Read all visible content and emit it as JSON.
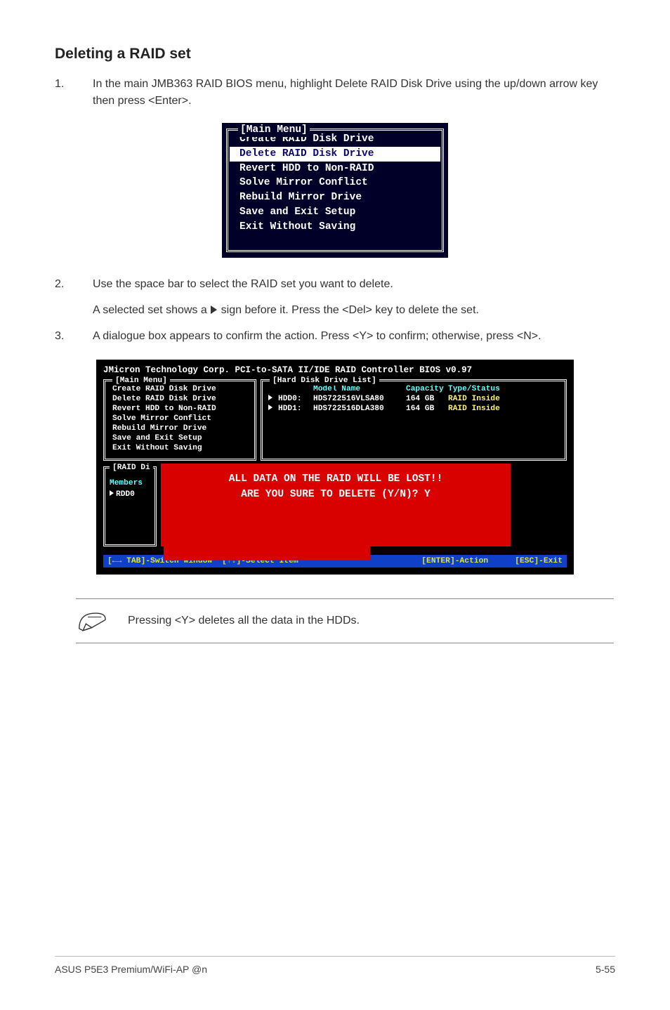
{
  "heading": "Deleting a RAID set",
  "steps": {
    "s1_num": "1.",
    "s1_text": "In the main JMB363 RAID BIOS menu, highlight Delete RAID Disk Drive using the up/down arrow key then press <Enter>.",
    "s2_num": "2.",
    "s2_text": "Use the space bar to select the RAID set you want to delete.",
    "s2_extra_a": "A selected set shows a ",
    "s2_extra_b": " sign before it. Press the <Del> key to delete the set.",
    "s3_num": "3.",
    "s3_text": "A dialogue box appears to confirm the action. Press <Y> to confirm; otherwise, press <N>."
  },
  "small_menu": {
    "title": "[Main Menu]",
    "items": [
      "Create RAID Disk Drive",
      "Delete RAID Disk Drive",
      "Revert HDD to Non-RAID",
      "Solve Mirror Conflict",
      "Rebuild Mirror Drive",
      "Save and Exit Setup",
      "Exit Without Saving"
    ],
    "selected_index": 1
  },
  "large": {
    "title": "JMicron Technology Corp. PCI-to-SATA II/IDE RAID Controller BIOS v0.97",
    "main_title": "[Main Menu]",
    "main_items": [
      "Create RAID Disk Drive",
      "Delete RAID Disk Drive",
      "Revert HDD to Non-RAID",
      "Solve Mirror Conflict",
      "Rebuild Mirror Drive",
      "Save and Exit Setup",
      "Exit Without Saving"
    ],
    "hdd_title": "[Hard Disk Drive List]",
    "hdd_header": {
      "model": "Model Name",
      "cap": "Capacity",
      "type": "Type/Status"
    },
    "hdd_rows": [
      {
        "slot": "HDD0:",
        "model": "HDS722516VLSA80",
        "cap": "164 GB",
        "type": "RAID Inside"
      },
      {
        "slot": "HDD1:",
        "model": "HDS722516DLA380",
        "cap": "164 GB",
        "type": "RAID Inside"
      }
    ],
    "raid_title": "[RAID Di",
    "raid_members": "Members",
    "raid_entry": "RDD0",
    "redbox_line1": "ALL DATA ON THE RAID WILL BE LOST!!",
    "redbox_line2": "ARE YOU SURE TO DELETE (Y/N)? Y",
    "keybar": {
      "tab": "TAB]-Switch Window",
      "sel": "[↑↓]-Select Item",
      "enter": "[ENTER]-Action",
      "esc": "[ESC]-Exit"
    }
  },
  "note": "Pressing <Y> deletes all the data in the HDDs.",
  "footer_left": "ASUS P5E3 Premium/WiFi-AP @n",
  "footer_right": "5-55"
}
